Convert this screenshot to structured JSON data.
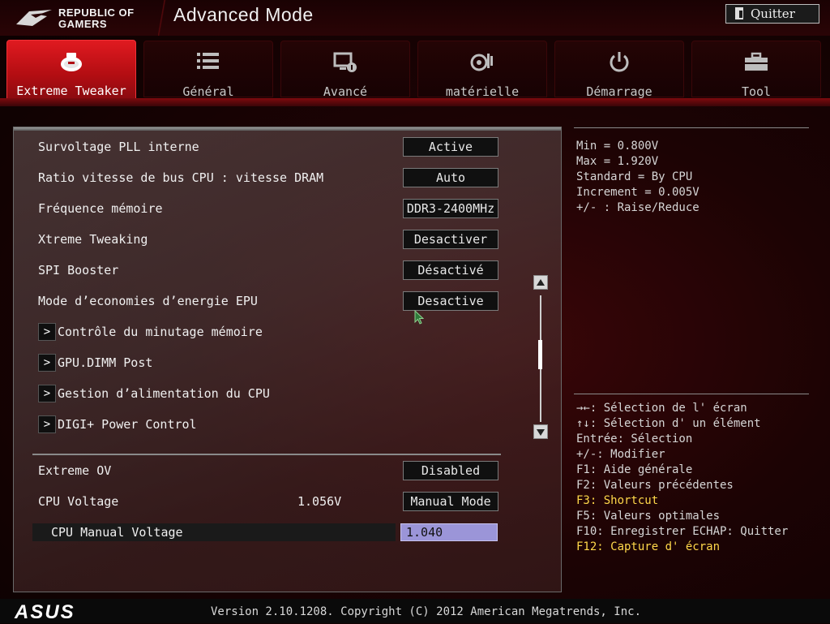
{
  "header": {
    "logo_line1": "REPUBLIC OF",
    "logo_line2": "GAMERS",
    "title": "Advanced Mode",
    "quit_label": "Quitter"
  },
  "tabs": [
    {
      "label": "Extreme Tweaker",
      "icon": "tweaker-icon",
      "active": true
    },
    {
      "label": "Général",
      "icon": "list-icon",
      "active": false
    },
    {
      "label": "Avancé",
      "icon": "advanced-icon",
      "active": false
    },
    {
      "label": "matérielle",
      "icon": "monitor-icon",
      "active": false
    },
    {
      "label": "Démarrage",
      "icon": "power-icon",
      "active": false
    },
    {
      "label": "Tool",
      "icon": "toolbox-icon",
      "active": false
    }
  ],
  "settings": [
    {
      "label": "Survoltage PLL interne",
      "value": "Active"
    },
    {
      "label": "Ratio vitesse de bus CPU : vitesse DRAM",
      "value": "Auto"
    },
    {
      "label": "Fréquence mémoire",
      "value": "DDR3-2400MHz"
    },
    {
      "label": "Xtreme Tweaking",
      "value": "Desactiver"
    },
    {
      "label": "SPI Booster",
      "value": "Désactivé"
    },
    {
      "label": "Mode d’economies d’energie EPU",
      "value": "Desactive"
    }
  ],
  "submenus": [
    {
      "label": "Contrôle du minutage mémoire"
    },
    {
      "label": "GPU.DIMM Post"
    },
    {
      "label": "Gestion d’alimentation du CPU"
    },
    {
      "label": "DIGI+ Power Control"
    }
  ],
  "lower": {
    "extreme_ov": {
      "label": "Extreme OV",
      "value": "Disabled"
    },
    "cpu_voltage": {
      "label": "CPU Voltage",
      "readout": "1.056V",
      "value": "Manual Mode"
    },
    "cpu_manual_voltage": {
      "label": "CPU Manual Voltage",
      "value": "1.040"
    }
  },
  "help_info": [
    "Min = 0.800V",
    "Max = 1.920V",
    "Standard = By CPU",
    "Increment = 0.005V",
    "+/- : Raise/Reduce"
  ],
  "key_help": [
    {
      "text": "→←: Sélection de l' écran",
      "highlight": false
    },
    {
      "text": "↑↓: Sélection d' un élément",
      "highlight": false
    },
    {
      "text": "Entrée: Sélection",
      "highlight": false
    },
    {
      "text": "+/-: Modifier",
      "highlight": false
    },
    {
      "text": "F1: Aide générale",
      "highlight": false
    },
    {
      "text": "F2: Valeurs précédentes",
      "highlight": false
    },
    {
      "text": "F3: Shortcut",
      "highlight": true
    },
    {
      "text": "F5: Valeurs optimales",
      "highlight": false
    },
    {
      "text": "F10: Enregistrer  ECHAP: Quitter",
      "highlight": false
    },
    {
      "text": "F12: Capture d' écran",
      "highlight": true
    }
  ],
  "footer": {
    "brand": "ASUS",
    "version_text": "Version 2.10.1208. Copyright (C) 2012 American Megatrends, Inc."
  },
  "colors": {
    "accent_red": "#e01a20",
    "highlight_yellow": "#ffd84a",
    "input_selected": "#9b95d8"
  }
}
